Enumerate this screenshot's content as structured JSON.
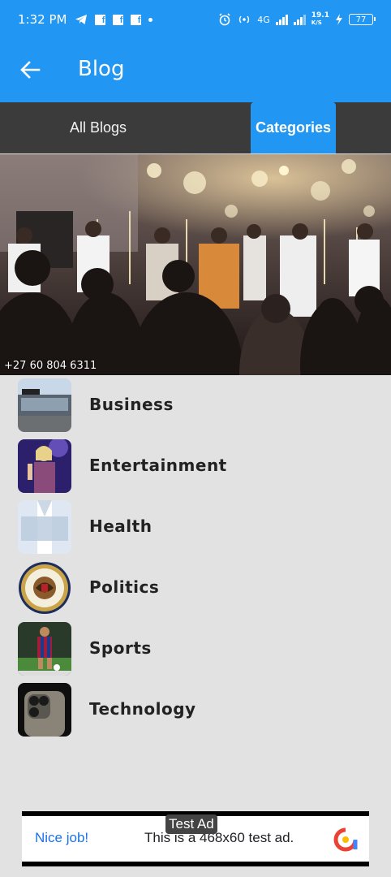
{
  "status_bar": {
    "time": "1:32 PM",
    "left_icons": [
      "telegram-icon",
      "facebook-icon",
      "facebook-icon",
      "facebook-icon",
      "dot-icon"
    ],
    "network": "4G",
    "speed": "19.1",
    "speed_unit": "K/S",
    "battery": "77"
  },
  "app_bar": {
    "title": "Blog",
    "back_icon": "arrow-left-icon",
    "color": "#2196f3"
  },
  "tabs": [
    {
      "label": "All Blogs",
      "active": false
    },
    {
      "label": "Categories",
      "active": true
    }
  ],
  "banner": {
    "phone": "+27 60 804 6311"
  },
  "categories": [
    {
      "label": "Business"
    },
    {
      "label": "Entertainment"
    },
    {
      "label": "Health"
    },
    {
      "label": "Politics"
    },
    {
      "label": "Sports"
    },
    {
      "label": "Technology"
    }
  ],
  "ad": {
    "badge": "Test Ad",
    "cta": "Nice job!",
    "text": "This is a 468x60 test ad."
  }
}
